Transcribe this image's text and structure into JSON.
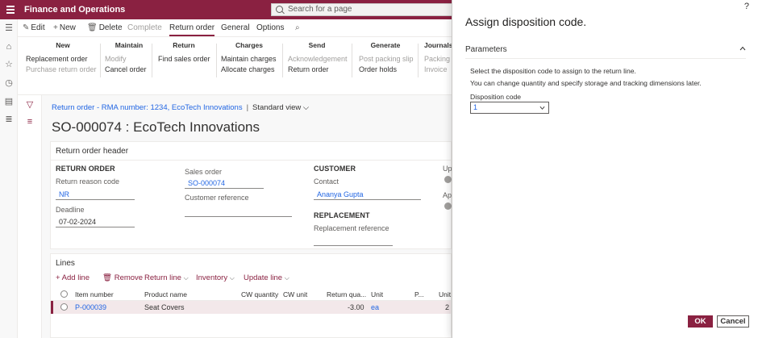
{
  "app": {
    "title": "Finance and Operations",
    "search_placeholder": "Search for a page"
  },
  "actionbar": {
    "edit": "Edit",
    "new": "New",
    "delete": "Delete",
    "complete": "Complete",
    "return_order": "Return order",
    "general": "General",
    "options": "Options"
  },
  "ribbon": {
    "groups": [
      {
        "header": "New",
        "items": [
          "Replacement order",
          "Purchase return order"
        ]
      },
      {
        "header": "Maintain",
        "items": [
          "Modify",
          "Cancel order"
        ]
      },
      {
        "header": "Return",
        "items": [
          "Find sales order"
        ]
      },
      {
        "header": "Charges",
        "items": [
          "Maintain charges",
          "Allocate charges"
        ]
      },
      {
        "header": "Send",
        "items": [
          "Acknowledgement",
          "Return order"
        ]
      },
      {
        "header": "Generate",
        "items": [
          "Post packing slip",
          "Order holds"
        ]
      },
      {
        "header": "Journals",
        "items": [
          "Packing s",
          "Invoice"
        ]
      }
    ]
  },
  "page": {
    "breadcrumb": "Return order - RMA number: 1234, EcoTech Innovations",
    "view": "Standard view",
    "title": "SO-000074 : EcoTech Innovations"
  },
  "header_card": {
    "title": "Return order header",
    "return_order_section": "RETURN ORDER",
    "return_reason_label": "Return reason code",
    "return_reason_value": "NR",
    "deadline_label": "Deadline",
    "deadline_value": "07-02-2024",
    "sales_order_label": "Sales order",
    "sales_order_value": "SO-000074",
    "customer_reference_label": "Customer reference",
    "customer_section": "CUSTOMER",
    "contact_label": "Contact",
    "contact_value": "Ananya Gupta",
    "replacement_section": "REPLACEMENT",
    "replacement_reference_label": "Replacement reference",
    "cut_label_1": "Up",
    "cut_label_2": "Ap"
  },
  "lines": {
    "title": "Lines",
    "toolbar": {
      "add_line": "Add line",
      "remove": "Remove",
      "return_line": "Return line",
      "inventory": "Inventory",
      "update_line": "Update line"
    },
    "columns": [
      "Item number",
      "Product name",
      "CW quantity",
      "CW unit",
      "Return qua...",
      "Unit",
      "P...",
      "Unit"
    ],
    "rows": [
      {
        "item_number": "P-000039",
        "product_name": "Seat Covers",
        "return_quantity": "-3.00",
        "unit": "ea",
        "unit_price": "2"
      }
    ]
  },
  "panel": {
    "help": "?",
    "title": "Assign disposition code.",
    "fasttab": "Parameters",
    "text1": "Select the disposition code to assign to the return line.",
    "text2": "You can change quantity and specify storage and tracking dimensions later.",
    "disposition_label": "Disposition code",
    "disposition_value": "1",
    "ok": "OK",
    "cancel": "Cancel"
  },
  "colors": {
    "brand": "#8a2141",
    "link": "#2266e3"
  }
}
